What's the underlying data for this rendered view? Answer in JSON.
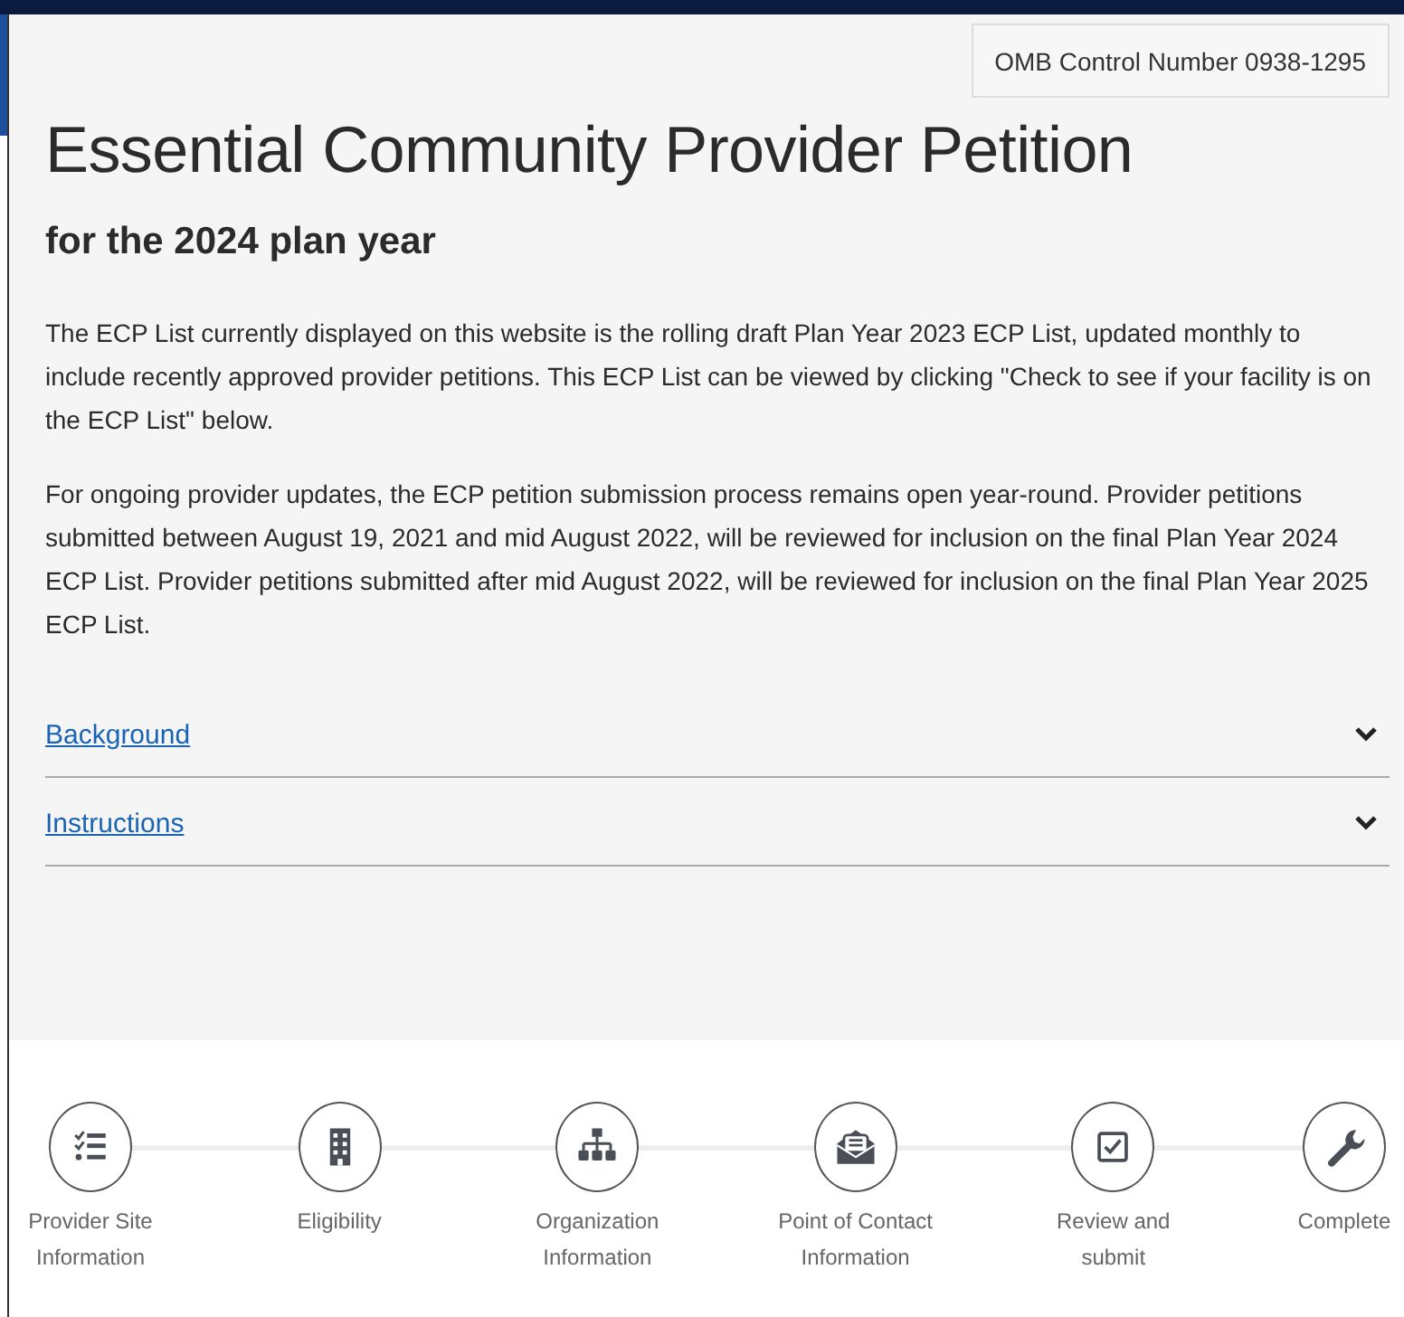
{
  "omb": "OMB Control Number 0938-1295",
  "title": "Essential Community Provider Petition",
  "subtitle": "for the 2024 plan year",
  "paragraphs": [
    "The ECP List currently displayed on this website is the rolling draft Plan Year 2023 ECP List, updated monthly to include recently approved provider petitions. This ECP List can be viewed by clicking \"Check to see if your facility is on the ECP List\" below.",
    "For ongoing provider updates, the ECP petition submission process remains open year-round. Provider petitions submitted between August 19, 2021 and mid August 2022, will be reviewed for inclusion on the final Plan Year 2024 ECP List. Provider petitions submitted after mid August 2022, will be reviewed for inclusion on the final Plan Year 2025 ECP List."
  ],
  "accordions": [
    {
      "label": "Background",
      "expanded": false
    },
    {
      "label": "Instructions",
      "expanded": false
    }
  ],
  "steps": [
    {
      "kind": "checklist",
      "label": "Provider Site Information"
    },
    {
      "kind": "building",
      "label": "Eligibility"
    },
    {
      "kind": "org",
      "label": "Organization Information"
    },
    {
      "kind": "contact",
      "label": "Point of Contact Information"
    },
    {
      "kind": "review",
      "label": "Review and submit"
    },
    {
      "kind": "wrench",
      "label": "Complete"
    }
  ]
}
